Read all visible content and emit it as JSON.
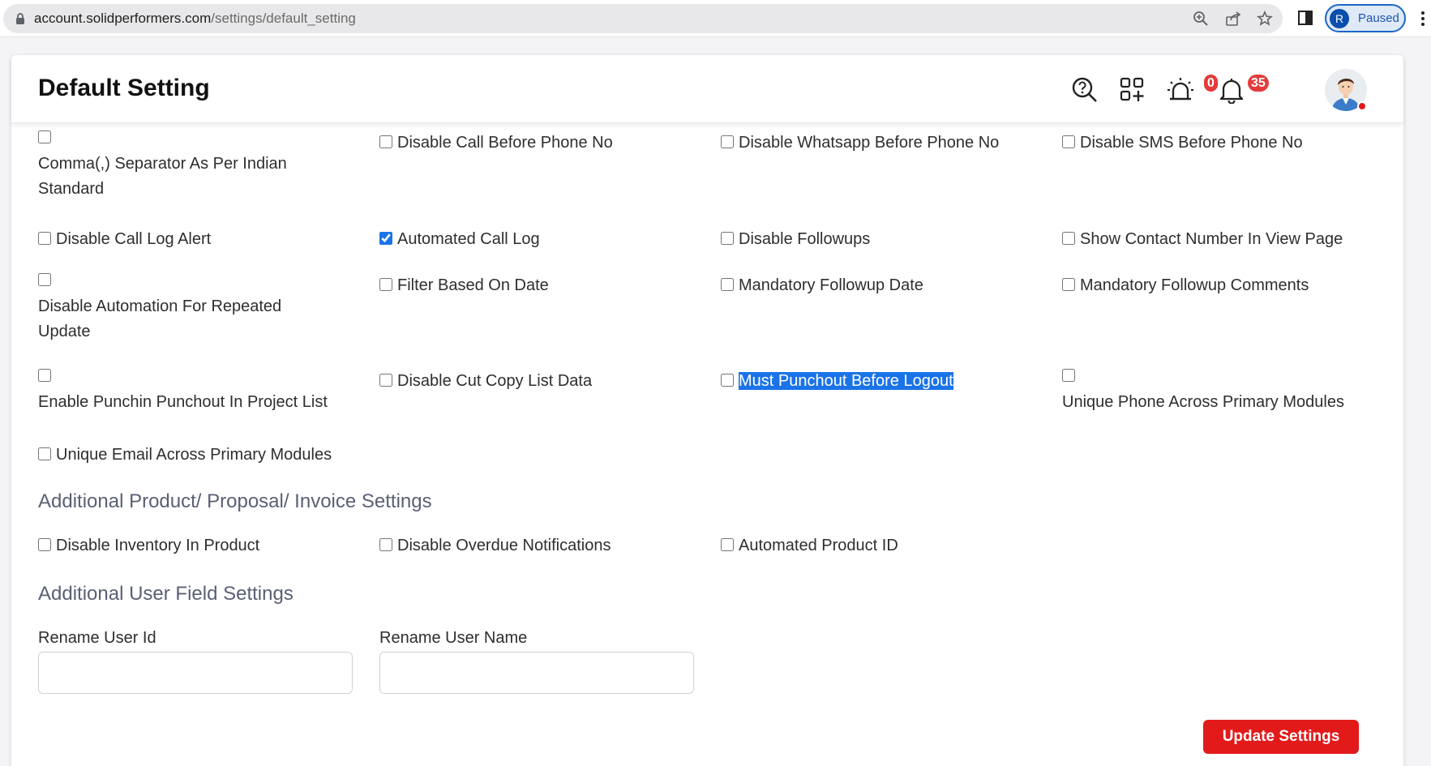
{
  "browser": {
    "url_host": "account.solidperformers.com",
    "url_path": "/settings/default_setting",
    "profile_initial": "R",
    "profile_status": "Paused"
  },
  "header": {
    "title": "Default Setting",
    "alerts_count": "0",
    "notifications_count": "35"
  },
  "options": {
    "comma_separator": {
      "label": "Comma(,) Separator As Per Indian Standard",
      "checked": false
    },
    "disable_call_before_phone": {
      "label": "Disable Call Before Phone No",
      "checked": false
    },
    "disable_whatsapp_before_phone": {
      "label": "Disable Whatsapp Before Phone No",
      "checked": false
    },
    "disable_sms_before_phone": {
      "label": "Disable SMS Before Phone No",
      "checked": false
    },
    "disable_call_log_alert": {
      "label": "Disable Call Log Alert",
      "checked": false
    },
    "automated_call_log": {
      "label": "Automated Call Log",
      "checked": true
    },
    "disable_followups": {
      "label": "Disable Followups",
      "checked": false
    },
    "show_contact_number": {
      "label": "Show Contact Number In View Page",
      "checked": false
    },
    "disable_automation_repeated": {
      "label": "Disable Automation For Repeated Update",
      "checked": false
    },
    "filter_based_on_date": {
      "label": "Filter Based On Date",
      "checked": false
    },
    "mandatory_followup_date": {
      "label": "Mandatory Followup Date",
      "checked": false
    },
    "mandatory_followup_comments": {
      "label": "Mandatory Followup Comments",
      "checked": false
    },
    "enable_punchin_punchout": {
      "label": "Enable Punchin Punchout In Project List",
      "checked": false
    },
    "disable_cut_copy": {
      "label": "Disable Cut Copy List Data",
      "checked": false
    },
    "must_punchout": {
      "label": "Must Punchout Before Logout",
      "checked": false
    },
    "unique_phone": {
      "label": "Unique Phone Across Primary Modules",
      "checked": false
    },
    "unique_email": {
      "label": "Unique Email Across Primary Modules",
      "checked": false
    }
  },
  "product_section": {
    "title": "Additional Product/ Proposal/ Invoice Settings",
    "disable_inventory": {
      "label": "Disable Inventory In Product",
      "checked": false
    },
    "disable_overdue": {
      "label": "Disable Overdue Notifications",
      "checked": false
    },
    "automated_product_id": {
      "label": "Automated Product ID",
      "checked": false
    }
  },
  "user_field_section": {
    "title": "Additional User Field Settings",
    "rename_user_id_label": "Rename User Id",
    "rename_user_id_value": "",
    "rename_user_name_label": "Rename User Name",
    "rename_user_name_value": ""
  },
  "actions": {
    "update_label": "Update Settings"
  },
  "colors": {
    "accent": "#1a73e8",
    "danger": "#e21a1a",
    "section_title": "#5a6075"
  }
}
